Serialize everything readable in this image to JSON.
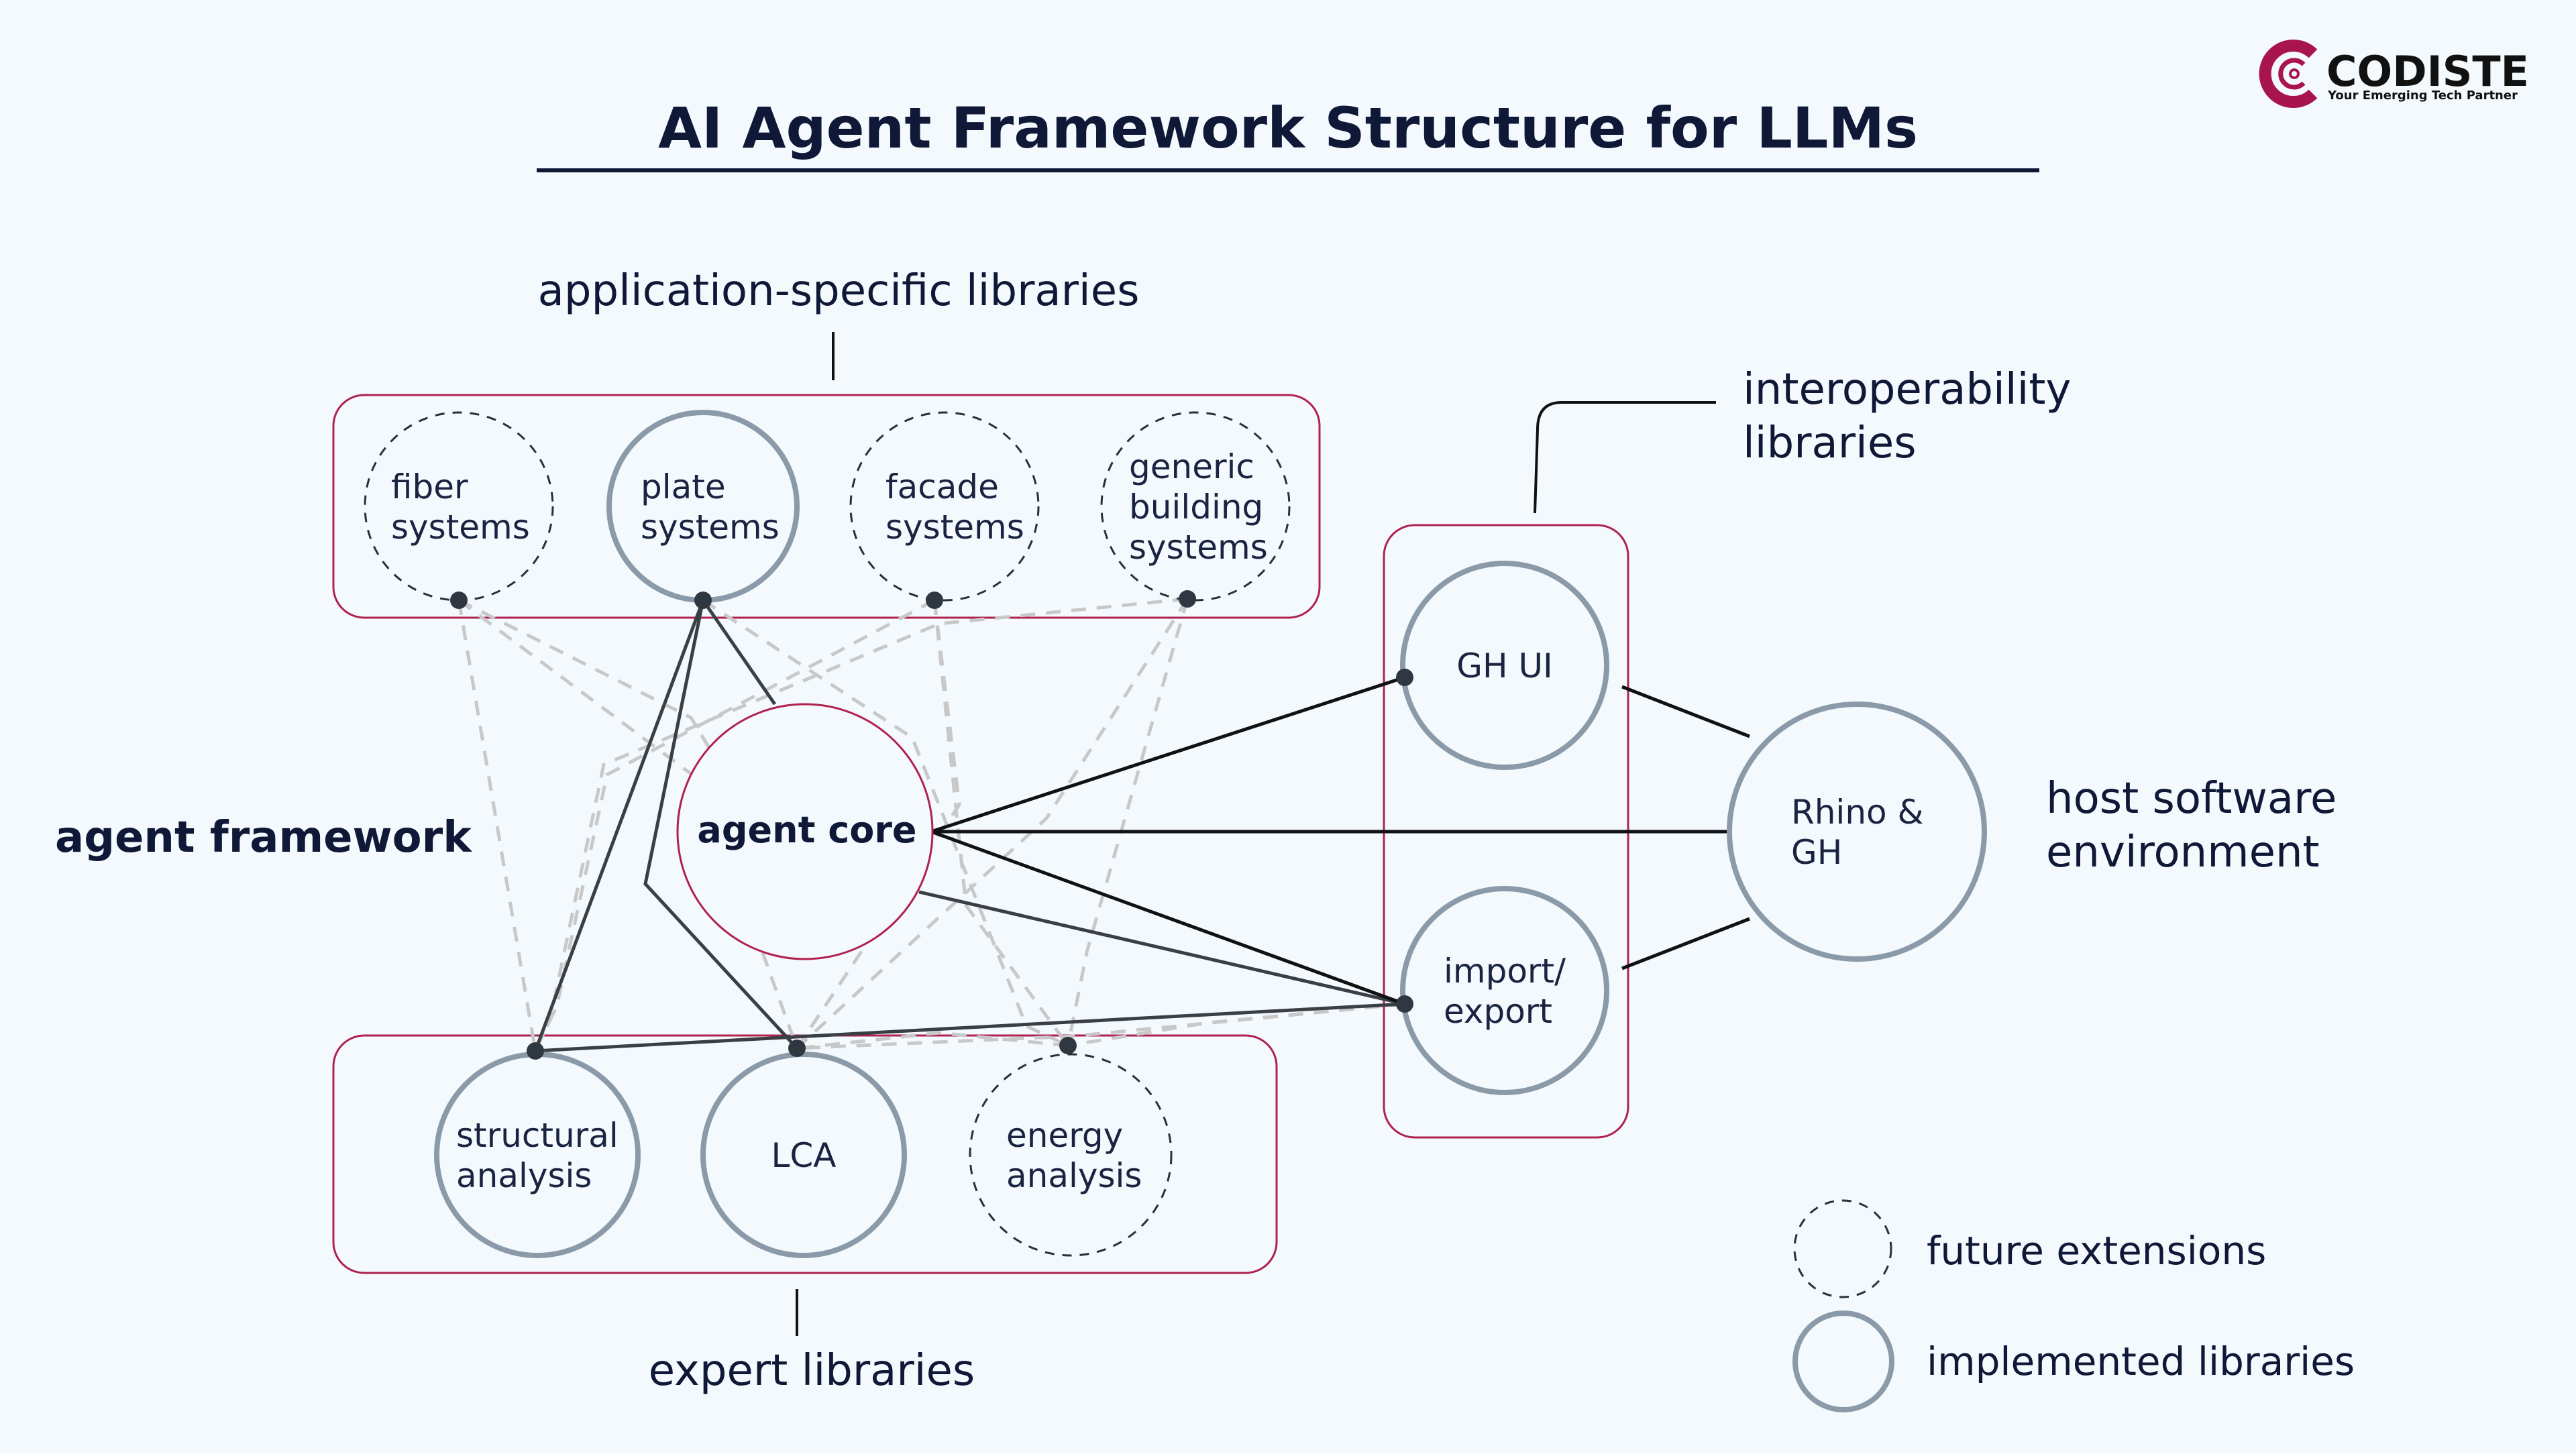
{
  "title": "AI Agent Framework Structure for LLMs",
  "logo": {
    "name": "CODISTE",
    "tagline": "Your Emerging Tech Partner",
    "brand_color": "#a8154e"
  },
  "colors": {
    "background": "#f4f9fd",
    "group_border": "#b0214e",
    "implemented_stroke": "#8a9aa8",
    "future_stroke": "#2b2f36",
    "solid_link": "#3a3f45",
    "strong_link": "#111111",
    "future_link": "#c8c8c8",
    "connector_dot": "#2f3740",
    "text": "#0f1836"
  },
  "groups": {
    "application": {
      "label": "application-specific libraries",
      "nodes": [
        {
          "id": "fiber",
          "lines": [
            "fiber",
            "systems"
          ],
          "status": "future"
        },
        {
          "id": "plate",
          "lines": [
            "plate",
            "systems"
          ],
          "status": "implemented"
        },
        {
          "id": "facade",
          "lines": [
            "facade",
            "systems"
          ],
          "status": "future"
        },
        {
          "id": "generic",
          "lines": [
            "generic",
            "building",
            "systems"
          ],
          "status": "future"
        }
      ]
    },
    "framework": {
      "label": "agent framework",
      "core": "agent core"
    },
    "expert": {
      "label": "expert libraries",
      "nodes": [
        {
          "id": "structural",
          "lines": [
            "structural",
            "analysis"
          ],
          "status": "implemented"
        },
        {
          "id": "lca",
          "lines": [
            "LCA"
          ],
          "status": "implemented"
        },
        {
          "id": "energy",
          "lines": [
            "energy",
            "analysis"
          ],
          "status": "future"
        }
      ]
    },
    "interop": {
      "label_lines": [
        "interoperability",
        "libraries"
      ],
      "nodes": [
        {
          "id": "ghui",
          "lines": [
            "GH UI"
          ],
          "status": "implemented"
        },
        {
          "id": "importexport",
          "lines": [
            "import/",
            "export"
          ],
          "status": "implemented"
        }
      ]
    },
    "host": {
      "label_lines": [
        "host software",
        "environment"
      ],
      "node": {
        "id": "rhino",
        "lines": [
          "Rhino &",
          "GH"
        ],
        "status": "implemented"
      }
    }
  },
  "legend": [
    {
      "label": "future extensions",
      "status": "future"
    },
    {
      "label": "implemented libraries",
      "status": "implemented"
    }
  ]
}
